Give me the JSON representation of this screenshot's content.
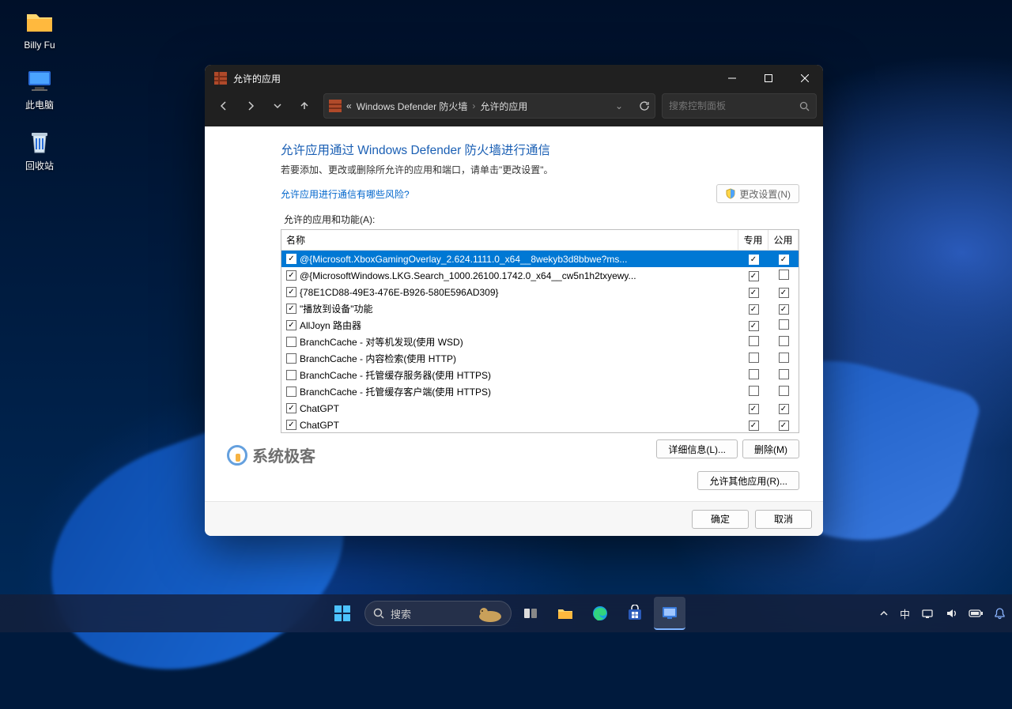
{
  "desktop": {
    "icons": [
      {
        "name": "Billy Fu",
        "icon": "folder"
      },
      {
        "name": "此电脑",
        "icon": "this-pc"
      },
      {
        "name": "回收站",
        "icon": "recycle-bin"
      }
    ]
  },
  "window": {
    "title": "允许的应用",
    "breadcrumb": {
      "prefix": "«",
      "parts": [
        "Windows Defender 防火墙",
        "允许的应用"
      ]
    },
    "search_placeholder": "搜索控制面板",
    "heading": "允许应用通过 Windows Defender 防火墙进行通信",
    "subtext": "若要添加、更改或删除所允许的应用和端口，请单击\"更改设置\"。",
    "risk_link": "允许应用进行通信有哪些风险?",
    "change_settings_btn": "更改设置(N)",
    "list_label": "允许的应用和功能(A):",
    "columns": {
      "name": "名称",
      "private": "专用",
      "public": "公用"
    },
    "rows": [
      {
        "name": "@{Microsoft.XboxGamingOverlay_2.624.1111.0_x64__8wekyb3d8bbwe?ms...",
        "enabled": true,
        "private": true,
        "public": true,
        "selected": true
      },
      {
        "name": "@{MicrosoftWindows.LKG.Search_1000.26100.1742.0_x64__cw5n1h2txyewy...",
        "enabled": true,
        "private": true,
        "public": false
      },
      {
        "name": "{78E1CD88-49E3-476E-B926-580E596AD309}",
        "enabled": true,
        "private": true,
        "public": true
      },
      {
        "name": "\"播放到设备\"功能",
        "enabled": true,
        "private": true,
        "public": true
      },
      {
        "name": "AllJoyn 路由器",
        "enabled": true,
        "private": true,
        "public": false
      },
      {
        "name": "BranchCache - 对等机发现(使用 WSD)",
        "enabled": false,
        "private": false,
        "public": false
      },
      {
        "name": "BranchCache - 内容检索(使用 HTTP)",
        "enabled": false,
        "private": false,
        "public": false
      },
      {
        "name": "BranchCache - 托管缓存服务器(使用 HTTPS)",
        "enabled": false,
        "private": false,
        "public": false
      },
      {
        "name": "BranchCache - 托管缓存客户端(使用 HTTPS)",
        "enabled": false,
        "private": false,
        "public": false
      },
      {
        "name": "ChatGPT",
        "enabled": true,
        "private": true,
        "public": true
      },
      {
        "name": "ChatGPT",
        "enabled": true,
        "private": true,
        "public": true
      }
    ],
    "details_btn": "详细信息(L)...",
    "delete_btn": "删除(M)",
    "allow_other_btn": "允许其他应用(R)...",
    "ok_btn": "确定",
    "cancel_btn": "取消"
  },
  "watermark": "系统极客",
  "taskbar": {
    "search_text": "搜索",
    "ime": "中"
  }
}
